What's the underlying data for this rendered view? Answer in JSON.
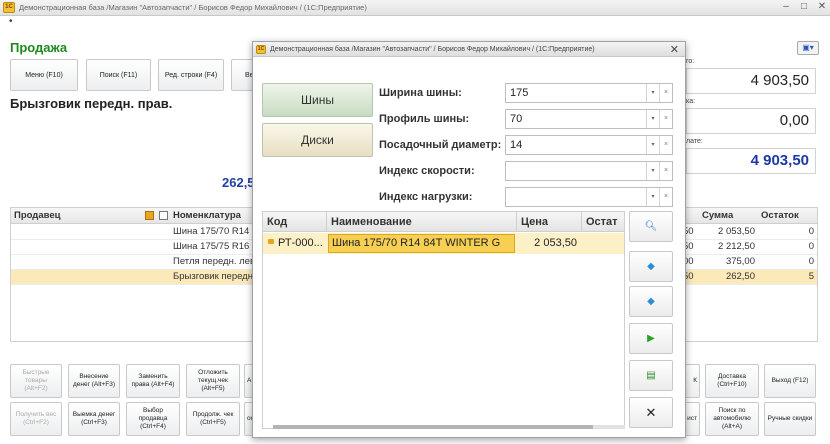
{
  "window": {
    "title": "Демонстрационная база /Магазин \"Автозапчасти\" / Борисов Федор Михайлович / (1С:Предприятие)",
    "app_icon": "1С"
  },
  "header": {
    "dot": "•",
    "section_title": "Продажа",
    "help_icon": "printer-dropdown-icon"
  },
  "toolbar": {
    "menu": "Меню (F10)",
    "search": "Поиск (F11)",
    "edit_row": "Ред. строки (F4)",
    "next_partial": "Ве"
  },
  "current_product": "Брызговик передн. прав.",
  "current_price": "262,5",
  "totals": {
    "total_label": "го:",
    "total_value": "4 903,50",
    "discount_label": "ка:",
    "discount_value": "0,00",
    "pay_label": "лате:",
    "pay_value": "4 903,50"
  },
  "table": {
    "headers": {
      "seller": "Продавец",
      "item": "Номенклатура",
      "sum": "Сумма",
      "stock": "Остаток"
    },
    "rows": [
      {
        "item": "Шина 175/70 R14 8",
        "qty": "50",
        "sum": "2 053,50",
        "stock": "0"
      },
      {
        "item": "Шина 175/75 R16 1",
        "qty": "50",
        "sum": "2 212,50",
        "stock": "0"
      },
      {
        "item": "Петля передн. лев",
        "qty": "00",
        "sum": "375,00",
        "stock": "0"
      },
      {
        "item": "Брызговик передн",
        "qty": "50",
        "sum": "262,50",
        "stock": "5"
      }
    ]
  },
  "bottom_buttons": {
    "quick_goods": "Быстрые товары (Alt+F2)",
    "cash_in": "Внесение денег (Alt+F3)",
    "change_rights": "Заменить права (Alt+F4)",
    "defer_check": "Отложить текущ.чек (Alt+F5)",
    "get_weight": "Получить вес (Ctrl+F2)",
    "cash_out": "Выемка денег (Ctrl+F3)",
    "choose_seller": "Выбор продавца (Ctrl+F4)",
    "continue_check": "Продолж. чек (Ctrl+F5)",
    "partial_a": "А",
    "partial_o": "ос",
    "partial_k": "К",
    "partial_ist": "ист",
    "delivery": "Доставка (Ctrl+F10)",
    "exit": "Выход (F12)",
    "search_by_car": "Поиск по автомобилю (Alt+A)",
    "manual_discounts": "Ручные скидки"
  },
  "modal": {
    "title": "Демонстрационная база /Магазин \"Автозапчасти\" / Борисов Федор Михайлович / (1С:Предприятие)",
    "categories": {
      "tires": "Шины",
      "disks": "Диски"
    },
    "fields": [
      {
        "label": "Ширина шины:",
        "value": "175"
      },
      {
        "label": "Профиль шины:",
        "value": "70"
      },
      {
        "label": "Посадочный диаметр:",
        "value": "14"
      },
      {
        "label": "Индекс скорости:",
        "value": ""
      },
      {
        "label": "Индекс нагрузки:",
        "value": ""
      }
    ],
    "grid": {
      "headers": {
        "code": "Код",
        "name": "Наименование",
        "price": "Цена",
        "stock": "Остат"
      },
      "row": {
        "code": "РТ-000...",
        "name": "Шина 175/70 R14 84T WINTER G",
        "price": "2 053,50"
      }
    },
    "side_icons": [
      "search-icon",
      "move-up-icon",
      "move-down-icon",
      "select-play-icon",
      "add-to-cart-icon",
      "close-x-icon"
    ]
  }
}
